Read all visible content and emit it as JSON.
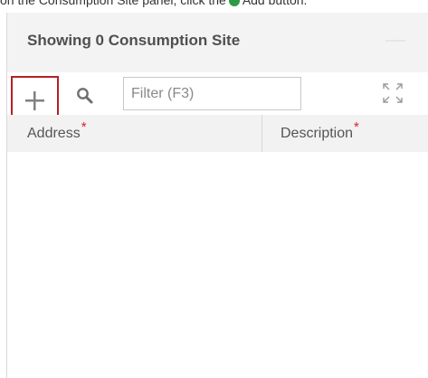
{
  "caption": {
    "text_before": "on the Consumption Site panel, click the",
    "text_after": "Add button."
  },
  "panel": {
    "title": "Showing 0 Consumption Site"
  },
  "toolbar": {
    "add_icon": "plus-icon",
    "search_icon": "magnifier-icon",
    "filter_placeholder": "Filter (F3)",
    "filter_value": "",
    "expand_icon": "expand-arrows-icon"
  },
  "grid": {
    "columns": [
      {
        "label": "Address",
        "required": true
      },
      {
        "label": "Description",
        "required": true
      }
    ],
    "required_marker": "*",
    "rows": []
  },
  "colors": {
    "highlight_border": "#b62025",
    "required_marker": "#e02020",
    "header_bg": "#f3f3f3"
  }
}
